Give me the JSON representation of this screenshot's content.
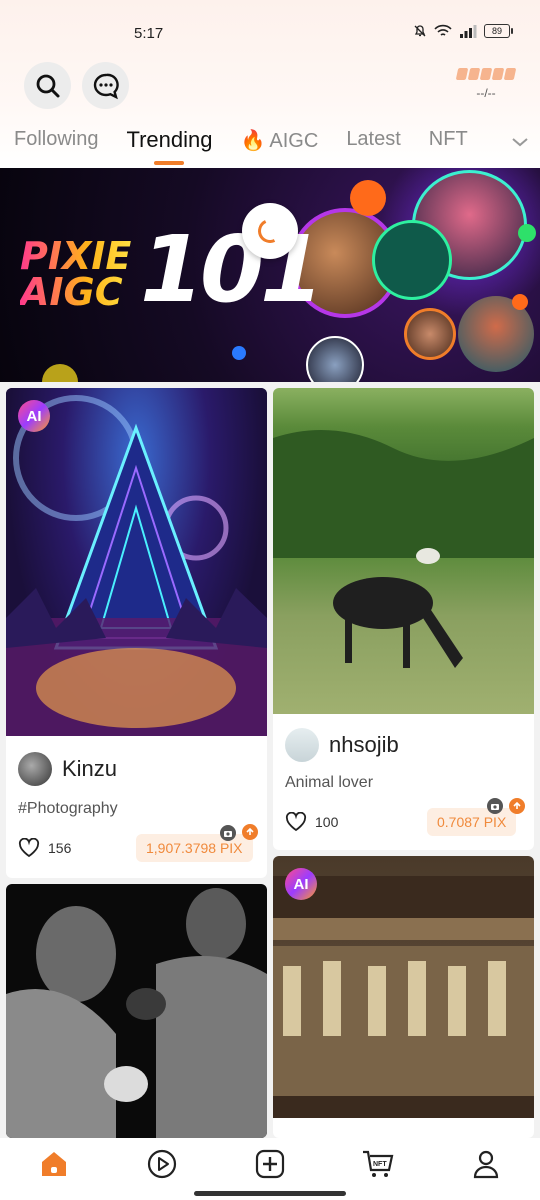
{
  "status_bar": {
    "time": "5:17",
    "battery": "89"
  },
  "header": {
    "points_value": "--/--",
    "tabs": [
      {
        "label": "Following"
      },
      {
        "label": "Trending"
      },
      {
        "label": "AIGC"
      },
      {
        "label": "Latest"
      },
      {
        "label": "NFT"
      }
    ]
  },
  "banner": {
    "line1": "PIXIE",
    "line2": "AIGC",
    "big": "101"
  },
  "cards": [
    {
      "ai_badge": "AI",
      "author": "Kinzu",
      "desc": "#Photography",
      "likes": "156",
      "price": "1,907.3798 PIX"
    },
    {
      "author": "nhsojib",
      "desc": "Animal lover",
      "likes": "100",
      "price": "0.7087 PIX"
    },
    {},
    {
      "ai_badge": "AI"
    }
  ],
  "colors": {
    "accent": "#f07d2a",
    "price_bg": "#fdeee2",
    "price_text": "#f08a3c"
  },
  "bottom_nav": [
    "home-icon",
    "play-icon",
    "create-icon",
    "nft-cart-icon",
    "profile-icon"
  ]
}
